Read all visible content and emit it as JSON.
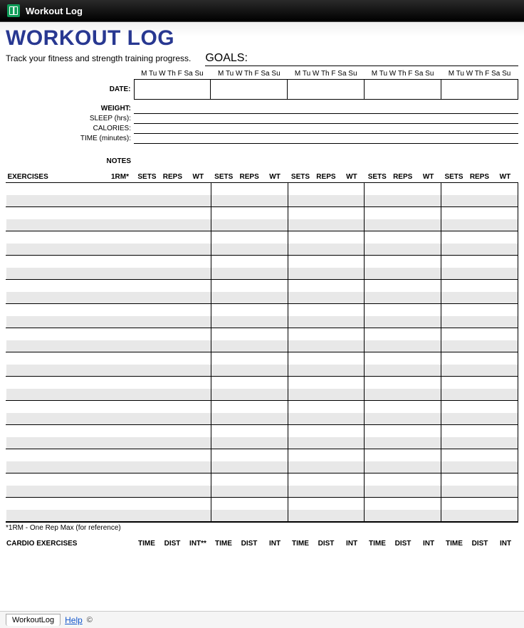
{
  "topbar": {
    "title": "Workout Log"
  },
  "page": {
    "title": "WORKOUT LOG",
    "tagline": "Track your fitness and strength training progress.",
    "goals_label": "GOALS:"
  },
  "days": "M Tu W Th F Sa Su",
  "labels": {
    "date": "DATE:",
    "weight": "WEIGHT:",
    "sleep": "SLEEP (hrs):",
    "calories": "CALORIES:",
    "time": "TIME (minutes):",
    "notes": "NOTES"
  },
  "exercise": {
    "header": "EXERCISES",
    "rm": "1RM*",
    "cols": [
      "SETS",
      "REPS",
      "WT"
    ],
    "footnote": "*1RM - One Rep Max (for reference)"
  },
  "cardio": {
    "header": "CARDIO EXERCISES",
    "cols_first": [
      "TIME",
      "DIST",
      "INT**"
    ],
    "cols": [
      "TIME",
      "DIST",
      "INT"
    ]
  },
  "tabs": {
    "sheet": "WorkoutLog",
    "help": "Help",
    "cc": "©"
  }
}
